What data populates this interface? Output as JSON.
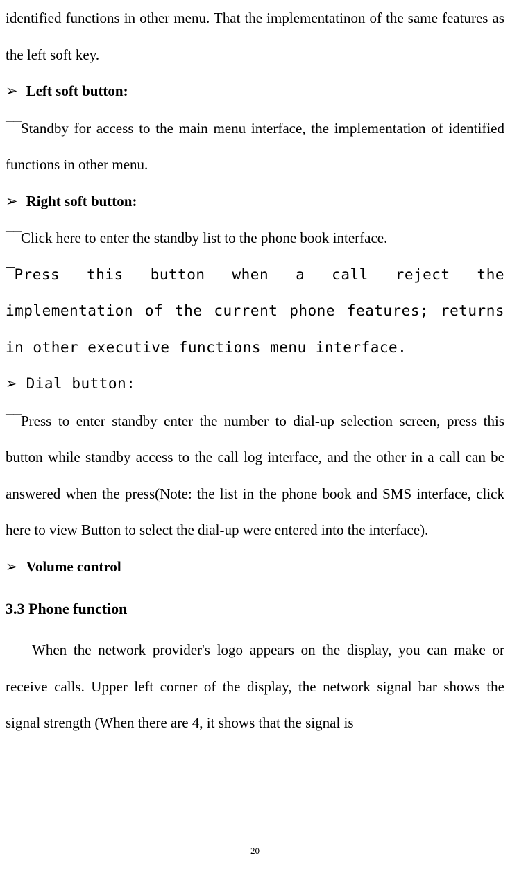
{
  "intro": {
    "line1": "identified functions in other menu. That the implementatinon of the same features as the left soft key."
  },
  "sections": {
    "leftSoft": {
      "title": "Left soft button:",
      "body": "Standby for access to the main menu interface, the implementation of identified functions in other menu."
    },
    "rightSoft": {
      "title": "Right soft button:",
      "body1": "Click here to enter the standby list to the phone book interface.",
      "body2": "Press this button when a call reject the implementation of the current phone features; returns in other executive functions menu interface."
    },
    "dial": {
      "title": "Dial button:",
      "body": "Press to enter standby enter the number to dial-up selection screen, press this button while standby access to the call log interface, and the other in a call can be answered when the press(Note: the list in the phone book and SMS interface, click here to view Button to select the dial-up were entered into the interface)."
    },
    "volume": {
      "title": "Volume control"
    }
  },
  "heading": "3.3 Phone function",
  "phoneFunction": {
    "body": "When the network provider's logo appears on the display, you can make or receive calls. Upper left corner of the display, the network signal bar shows the signal strength (When there are 4, it shows that the signal is"
  },
  "pageNumber": "20",
  "glyphs": {
    "arrow": "➢",
    "dash": "——"
  }
}
